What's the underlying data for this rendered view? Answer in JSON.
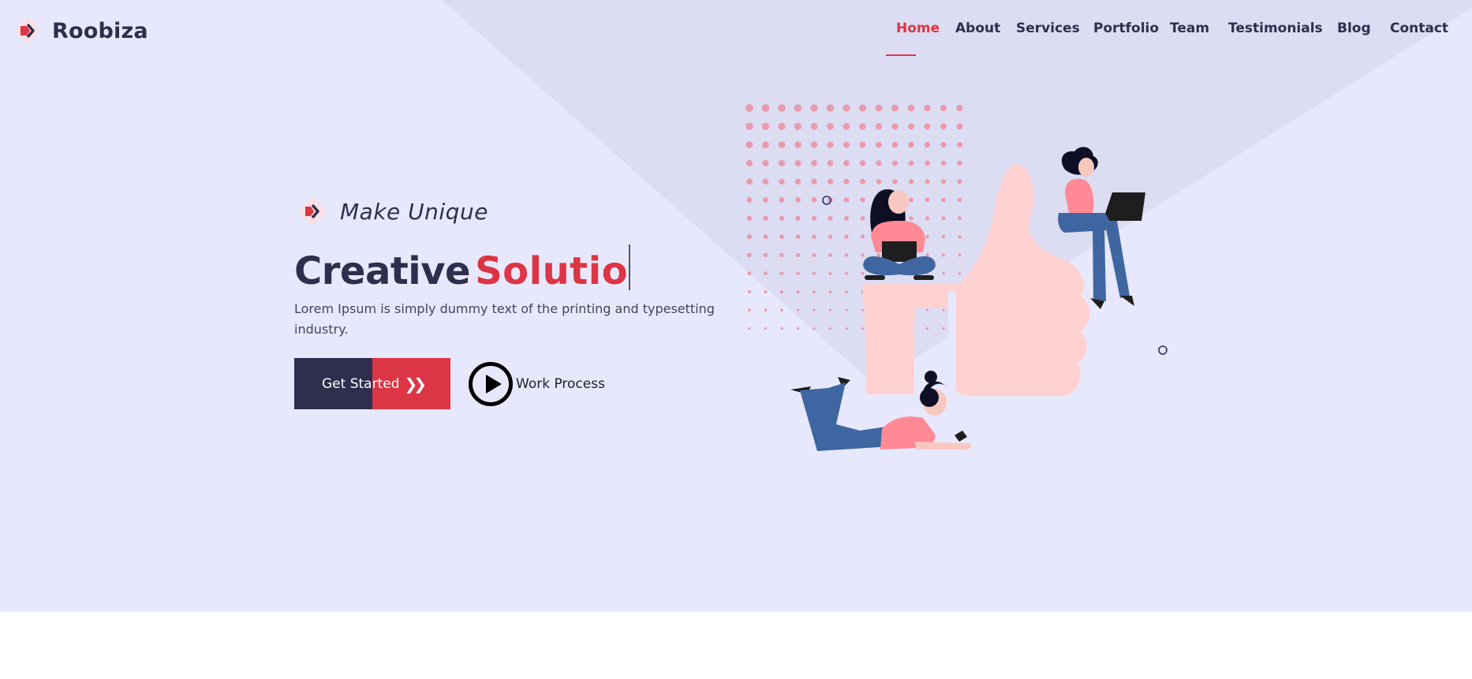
{
  "brand": {
    "name": "Roobiza",
    "logo_icon": "diamond-arrow-icon"
  },
  "nav": {
    "items": [
      {
        "label": "Home",
        "active": true
      },
      {
        "label": "About",
        "active": false
      },
      {
        "label": "Services",
        "active": false
      },
      {
        "label": "Portfolio",
        "active": false
      },
      {
        "label": "Team",
        "active": false
      },
      {
        "label": "Testimonials",
        "active": false
      },
      {
        "label": "Blog",
        "active": false
      },
      {
        "label": "Contact",
        "active": false
      }
    ]
  },
  "hero": {
    "tagline": "Make Unique",
    "headline_main": "Creative",
    "headline_accent": "Solutio",
    "description": "Lorem Ipsum is simply dummy text of the printing and typesetting industry.",
    "cta_label": "Get Started",
    "cta_icon": "double-chevron-right-icon",
    "secondary_label": "Work Process",
    "secondary_icon": "play-circle-icon",
    "illustration": "thumbs-up-team-illustration"
  },
  "colors": {
    "background": "#e8e8fc",
    "background_shape": "#dcdcf2",
    "primary_dark": "#2e2e4e",
    "accent": "#dc3545",
    "illustration_pink": "#ffd1d1",
    "illustration_blue": "#3f66a0"
  }
}
